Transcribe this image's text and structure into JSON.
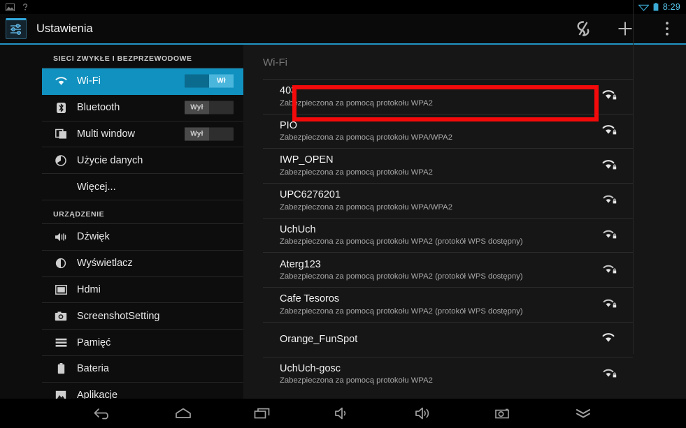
{
  "statusbar": {
    "notification_icons": [
      "image-icon",
      "help-icon"
    ],
    "wifi_icon": "wifi-signal-icon",
    "battery_icon": "battery-icon",
    "clock": "8:29"
  },
  "actionbar": {
    "app_icon": "settings-sliders-icon",
    "title": "Ustawienia",
    "actions": [
      {
        "name": "scan-refresh-button",
        "icon": "scan-icon"
      },
      {
        "name": "add-network-button",
        "icon": "plus-icon"
      },
      {
        "name": "overflow-menu-button",
        "icon": "more-vertical-icon"
      }
    ]
  },
  "sidebar": {
    "groups": [
      {
        "header": "SIECI ZWYKŁE I BEZPRZEWODOWE",
        "items": [
          {
            "label": "Wi-Fi",
            "icon": "wifi-icon",
            "selected": true,
            "toggle": {
              "state": "on",
              "label": "Wł"
            }
          },
          {
            "label": "Bluetooth",
            "icon": "bluetooth-icon",
            "selected": false,
            "toggle": {
              "state": "off",
              "label": "Wył"
            }
          },
          {
            "label": "Multi window",
            "icon": "multiwindow-icon",
            "selected": false,
            "toggle": {
              "state": "off",
              "label": "Wył"
            }
          },
          {
            "label": "Użycie danych",
            "icon": "data-usage-icon",
            "selected": false,
            "toggle": null
          },
          {
            "label": "Więcej...",
            "icon": null,
            "selected": false,
            "toggle": null
          }
        ]
      },
      {
        "header": "URZĄDZENIE",
        "items": [
          {
            "label": "Dźwięk",
            "icon": "sound-icon",
            "selected": false,
            "toggle": null
          },
          {
            "label": "Wyświetlacz",
            "icon": "display-icon",
            "selected": false,
            "toggle": null
          },
          {
            "label": "Hdmi",
            "icon": "hdmi-icon",
            "selected": false,
            "toggle": null
          },
          {
            "label": "ScreenshotSetting",
            "icon": "camera-icon",
            "selected": false,
            "toggle": null
          },
          {
            "label": "Pamięć",
            "icon": "storage-icon",
            "selected": false,
            "toggle": null
          },
          {
            "label": "Bateria",
            "icon": "battery-icon",
            "selected": false,
            "toggle": null
          },
          {
            "label": "Aplikacje",
            "icon": "apps-icon",
            "selected": false,
            "toggle": null
          }
        ]
      }
    ]
  },
  "panel": {
    "title": "Wi-Fi",
    "highlight_color": "#f40a0a",
    "highlighted_network": "403",
    "networks": [
      {
        "ssid": "403",
        "security": "Zabezpieczona za pomocą protokołu WPA2",
        "signal": 3,
        "locked": true
      },
      {
        "ssid": "PIO",
        "security": "Zabezpieczona za pomocą protokołu WPA/WPA2",
        "signal": 3,
        "locked": true
      },
      {
        "ssid": "IWP_OPEN",
        "security": "Zabezpieczona za pomocą protokołu WPA2",
        "signal": 3,
        "locked": true
      },
      {
        "ssid": "UPC6276201",
        "security": "Zabezpieczona za pomocą protokołu WPA/WPA2",
        "signal": 2,
        "locked": true
      },
      {
        "ssid": "UchUch",
        "security": "Zabezpieczona za pomocą protokołu WPA2 (protokół WPS dostępny)",
        "signal": 2,
        "locked": true
      },
      {
        "ssid": "Aterg123",
        "security": "Zabezpieczona za pomocą protokołu WPA2 (protokół WPS dostępny)",
        "signal": 2,
        "locked": true
      },
      {
        "ssid": "Cafe Tesoros",
        "security": "Zabezpieczona za pomocą protokołu WPA2 (protokół WPS dostępny)",
        "signal": 2,
        "locked": true
      },
      {
        "ssid": "Orange_FunSpot",
        "security": "",
        "signal": 3,
        "locked": false
      },
      {
        "ssid": "UchUch-gosc",
        "security": "Zabezpieczona za pomocą protokołu WPA2",
        "signal": 2,
        "locked": true
      }
    ]
  },
  "navbar": {
    "buttons": [
      {
        "name": "nav-back-button",
        "icon": "back-arrow-icon"
      },
      {
        "name": "nav-home-button",
        "icon": "home-icon"
      },
      {
        "name": "nav-recents-button",
        "icon": "recent-apps-icon"
      },
      {
        "name": "nav-volume-down-button",
        "icon": "volume-down-icon"
      },
      {
        "name": "nav-volume-up-button",
        "icon": "volume-up-icon"
      },
      {
        "name": "nav-screenshot-button",
        "icon": "camera-icon"
      },
      {
        "name": "nav-hide-button",
        "icon": "chevron-down-icon"
      }
    ]
  }
}
